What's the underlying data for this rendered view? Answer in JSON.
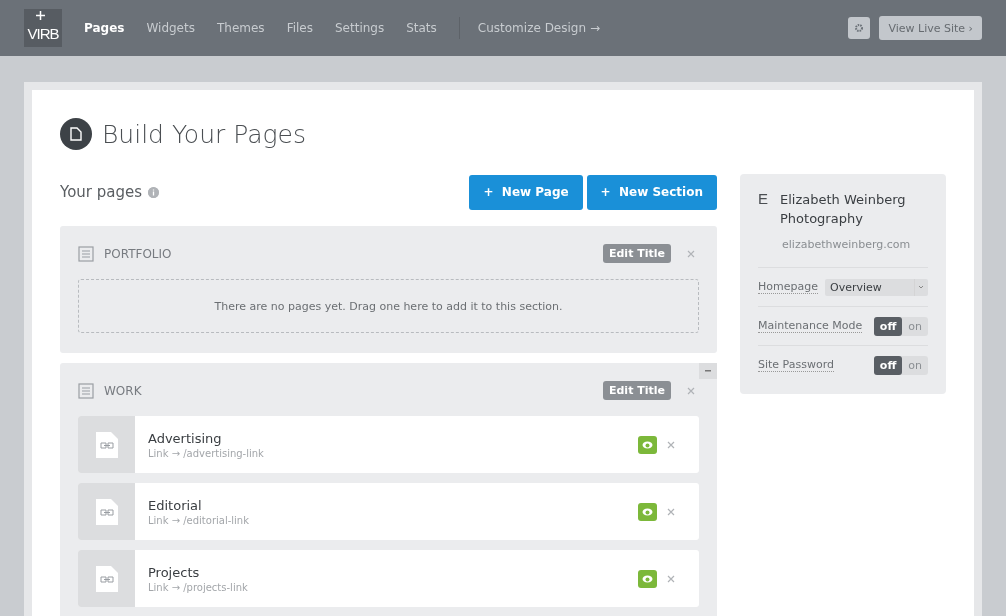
{
  "topbar": {
    "logo": "VIRB",
    "nav": [
      {
        "label": "Pages",
        "selected": true
      },
      {
        "label": "Widgets",
        "selected": false
      },
      {
        "label": "Themes",
        "selected": false
      },
      {
        "label": "Files",
        "selected": false
      },
      {
        "label": "Settings",
        "selected": false
      },
      {
        "label": "Stats",
        "selected": false
      }
    ],
    "customize": "Customize Design →",
    "live_button": "View Live Site ›"
  },
  "heading": "Build Your Pages",
  "subheading": "Your pages",
  "buttons": [
    "+  New Page",
    "+  New Section"
  ],
  "sections": [
    {
      "title": "PORTFOLIO",
      "edit_button": "Edit Title",
      "collapsible": false,
      "empty_text": "There are no pages yet. Drag one here to add it to this section."
    },
    {
      "title": "WORK",
      "edit_button": "Edit Title",
      "collapsible": true,
      "pages": [
        {
          "name": "Advertising",
          "link": "Link → /advertising-link",
          "visible": true
        },
        {
          "name": "Editorial",
          "link": "Link → /editorial-link",
          "visible": true
        },
        {
          "name": "Projects",
          "link": "Link → /projects-link",
          "visible": true
        }
      ]
    }
  ],
  "site": {
    "initial": "E",
    "name": "Elizabeth Weinberg Photography",
    "url": "elizabethweinberg.com",
    "homepage": {
      "label": "Homepage",
      "value": "Overview"
    },
    "toggles": [
      {
        "label": "Maintenance Mode",
        "options": [
          {
            "label": "off",
            "selected": true
          },
          {
            "label": "on",
            "selected": false
          }
        ]
      },
      {
        "label": "Site Password",
        "options": [
          {
            "label": "off",
            "selected": true
          },
          {
            "label": "on",
            "selected": false
          }
        ]
      }
    ]
  }
}
